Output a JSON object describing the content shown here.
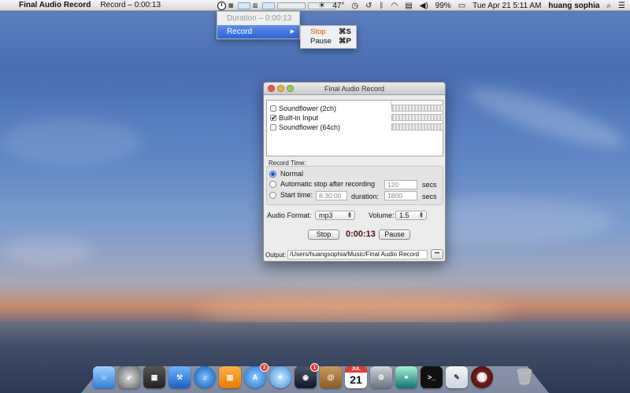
{
  "menubar": {
    "app_name": "Final Audio Record",
    "record_status": "Record – 0:00:13",
    "temperature": "47°",
    "battery": "99%",
    "datetime": "Tue Apr 21  5:11 AM",
    "user": "huang sophia"
  },
  "status_menu": {
    "duration": "Duration – 0:00:13",
    "record": "Record",
    "submenu": {
      "stop_label": "Stop",
      "stop_shortcut": "⌘S",
      "pause_label": "Pause",
      "pause_shortcut": "⌘P"
    }
  },
  "window": {
    "title": "Final Audio Record",
    "devices": [
      {
        "label": "Soundflower (2ch)",
        "checked": false
      },
      {
        "label": "Built-in Input",
        "checked": true
      },
      {
        "label": "Soundflower (64ch)",
        "checked": false
      }
    ],
    "record_time": {
      "section_label": "Record Time:",
      "normal": "Normal",
      "auto_stop": "Automatic stop after recording",
      "auto_stop_value": "120",
      "secs": "secs",
      "start_time": "Start time:",
      "start_time_value": "8:30:00",
      "duration_label": "duration:",
      "duration_value": "1800"
    },
    "audio_format_label": "Audio Format:",
    "audio_format_value": "mp3",
    "volume_label": "Volume:",
    "volume_value": "1.5",
    "stop_button": "Stop",
    "timer": "0:00:13",
    "pause_button": "Pause",
    "output_label": "Output:",
    "output_path": "/Users/huangsophia/Music/Final Audio Record",
    "browse_button": "•••"
  },
  "dock": {
    "calendar_month": "JUL",
    "calendar_day": "21",
    "appstore_badge": "3",
    "facetime_badge": "1"
  }
}
